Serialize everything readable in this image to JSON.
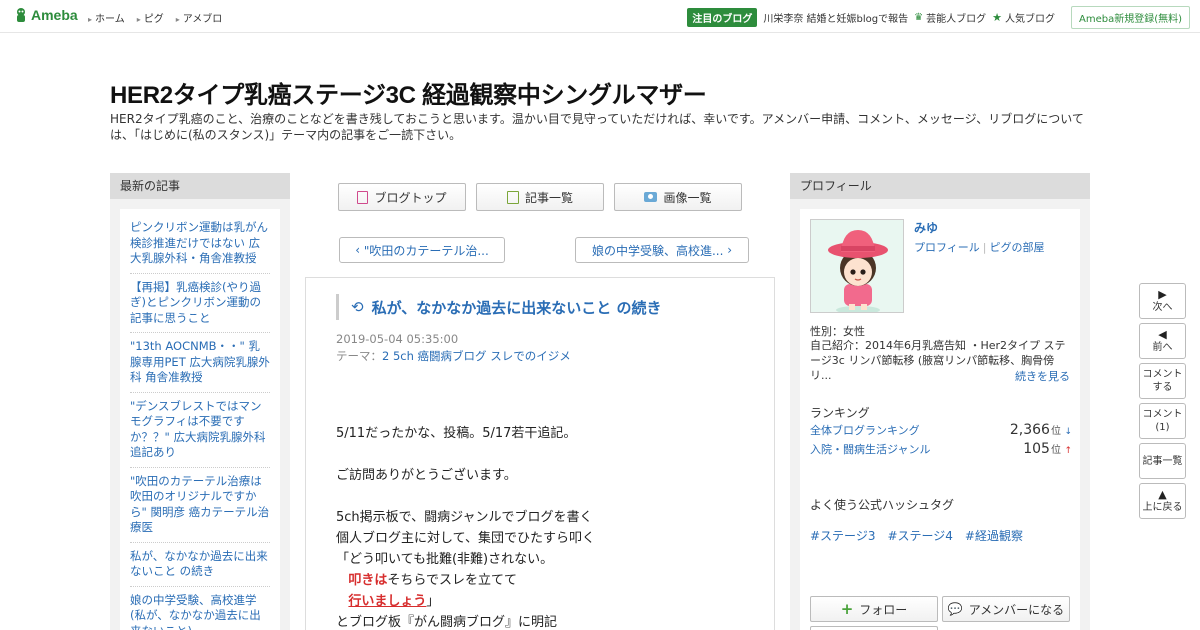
{
  "topbar": {
    "logo_text": "Ameba",
    "nav": [
      "ホーム",
      "ピグ",
      "アメブロ"
    ],
    "featured_label": "注目のブログ",
    "featured_text": "川栄李奈 結婚と妊娠blogで報告",
    "celeb_blog": "芸能人ブログ",
    "popular_blog": "人気ブログ",
    "register": "Ameba新規登録(無料)"
  },
  "header": {
    "title": "HER2タイプ乳癌ステージ3C 経過観察中シングルマザー",
    "description": "HER2タイプ乳癌のこと、治療のことなどを書き残しておこうと思います。温かい目で見守っていただければ、幸いです。アメンバー申請、コメント、メッセージ、リブログについては、「はじめに(私のスタンス)」テーマ内の記事をご一読下さい。"
  },
  "left": {
    "heading": "最新の記事",
    "items": [
      "ピンクリボン運動は乳がん検診推進だけではない 広大乳腺外科・角舎准教授",
      "【再掲】乳癌検診(やり過ぎ)とピンクリボン運動の記事に思うこと",
      "\"13th AOCNMB・・\" 乳腺専用PET 広大病院乳腺外科 角舎准教授",
      "\"デンスブレストではマンモグラフィは不要ですか？？\" 広大病院乳腺外科 追記あり",
      "\"吹田のカテーテル治療は吹田のオリジナルですから\" 関明彦 癌カテーテル治療医",
      "私が、なかなか過去に出来ないこと の続き",
      "娘の中学受験、高校進学(私が、なかなか過去に出来ないこと)"
    ]
  },
  "center": {
    "buttons": {
      "top": "ブログトップ",
      "list": "記事一覧",
      "images": "画像一覧"
    },
    "prev": "\"吹田のカテーテル治...",
    "next": "娘の中学受験、高校進...",
    "article": {
      "title": "私が、なかなか過去に出来ないこと の続き",
      "date": "2019-05-04 05:35:00",
      "theme_label": "テーマ：",
      "theme": "2 5ch 癌闘病ブログ スレでのイジメ",
      "body": {
        "l1": "5/11だったかな、投稿。5/17若干追記。",
        "l2": "ご訪問ありがとうございます。",
        "l3": "5ch掲示板で、闘病ジャンルでブログを書く",
        "l4": "個人ブログ主に対して、集団でひたすら叩く",
        "l5": "「どう叩いても批難(非難)されない。",
        "l6_red": "叩きは",
        "l6_rest": "そちらでスレを立てて",
        "l7_red": "行いましょう",
        "l7_rest": "」",
        "l8": "とブログ板『がん闘病ブログ』に明記"
      }
    }
  },
  "right": {
    "heading": "プロフィール",
    "name": "みゆ",
    "link_profile": "プロフィール",
    "link_pig": "ピグの部屋",
    "gender": "性別：女性",
    "intro": "自己紹介：2014年6月乳癌告知 ・Her2タイプ ステージ3c リンパ節転移 (腋窩リンパ節転移、胸骨傍リ...",
    "more": "続きを見る",
    "ranking_head": "ランキング",
    "rank1_label": "全体ブログランキング",
    "rank1_value": "2,366",
    "rank2_label": "入院・闘病生活ジャンル",
    "rank2_value": "105",
    "rank_unit": "位",
    "rank1_arrow": "↓",
    "rank2_arrow": "↑",
    "hashtag_head": "よく使う公式ハッシュタグ",
    "tags": [
      "#ステージ3",
      "#ステージ4",
      "#経過観察"
    ],
    "follow": "フォロー",
    "member": "アメンバーになる"
  },
  "floatnav": {
    "next": "次へ",
    "prev": "前へ",
    "comment1": "コメント",
    "comment2": "する",
    "comments1": "コメント",
    "comments2": "(1)",
    "list": "記事一覧",
    "top1": "上に戻る"
  },
  "colors": {
    "brand": "#2d8c3c",
    "link": "#2a6db5",
    "emphasis": "#d72e2e"
  }
}
